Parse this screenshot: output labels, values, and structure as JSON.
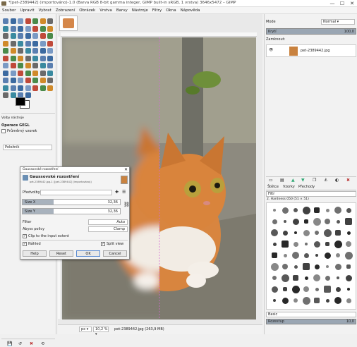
{
  "window": {
    "title": "*[pet-2389442] (importováno)-1.0 (Barva RGB 8-bit gamma integer, GIMP built-in sRGB, 1 vrstva) 3646x5472 – GIMP",
    "minimize": "—",
    "maximize": "☐",
    "close": "✕"
  },
  "menu": [
    "Soubor",
    "Upravit",
    "Vybrat",
    "Zobrazení",
    "Obrázek",
    "Vrstva",
    "Barvy",
    "Nástroje",
    "Filtry",
    "Okna",
    "Nápověda"
  ],
  "toolbox": {
    "options_title": "Volby nástroje",
    "tool_name": "Operace GEGL",
    "sample_merged": "Průměrný vzorek",
    "mode_label": "Položník"
  },
  "status": {
    "unit": "px ▾",
    "zoom": "10,2 % ▾",
    "file": "pet-2389442.jpg (263,9 MB)"
  },
  "layers": {
    "mode_label": "Mode",
    "mode_value": "Normal ▾",
    "opacity_label": "Krytí",
    "opacity_value": "100,0",
    "lock_label": "Zamknout:",
    "layer_name": "pet-2389442.jpg",
    "eye": "👁"
  },
  "brushes": {
    "tabs": [
      "Štětce",
      "Vzorky",
      "Přechody"
    ],
    "filter_placeholder": "Filtr",
    "current": "2. Hardness 050 (51 × 51)",
    "category": "Basic",
    "spacing_label": "Rozestup",
    "spacing_value": "10,0"
  },
  "dialog": {
    "title": "Gaussovské rozostření",
    "heading": "Gaussovské rozostření",
    "subtitle": "pet-2389442.jpg-1 ([pet-2389442] (importováno))",
    "presets_label": "Předvolby:",
    "size_x_label": "Size X",
    "size_x_value": "32,36",
    "size_x_fill": 0.32,
    "size_y_label": "Size Y",
    "size_y_value": "32,36",
    "size_y_fill": 0.32,
    "filter_label": "Filter",
    "filter_value": "Auto",
    "abyss_label": "Abyss policy",
    "abyss_value": "Clamp",
    "clip_label": "Clip to the input extent",
    "preview_label": "Náhled",
    "split_label": "Split view",
    "help_btn": "Help",
    "reset_btn": "Reset",
    "ok_btn": "OK",
    "cancel_btn": "Cancel"
  }
}
